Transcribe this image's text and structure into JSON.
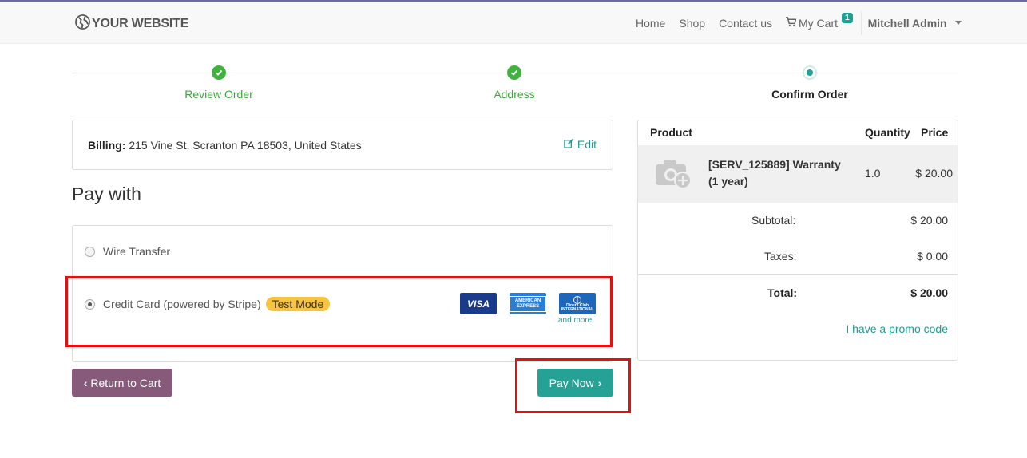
{
  "navbar": {
    "brand": "YOUR WEBSITE",
    "links": [
      "Home",
      "Shop",
      "Contact us"
    ],
    "cart_label": "My Cart",
    "cart_count": "1",
    "user_name": "Mitchell Admin"
  },
  "wizard": {
    "steps": [
      {
        "label": "Review Order",
        "status": "done"
      },
      {
        "label": "Address",
        "status": "done"
      },
      {
        "label": "Confirm Order",
        "status": "current"
      }
    ]
  },
  "billing": {
    "label": "Billing:",
    "address": "215 Vine St, Scranton PA 18503, United States",
    "edit_label": "Edit"
  },
  "payment": {
    "heading": "Pay with",
    "methods": [
      {
        "label": "Wire Transfer",
        "selected": false
      },
      {
        "label": "Credit Card (powered by Stripe)",
        "selected": true,
        "badge": "Test Mode"
      }
    ],
    "card_icons": [
      "VISA",
      "AMERICAN EXPRESS",
      "Diners Club INTERNATIONAL"
    ],
    "and_more": "and more"
  },
  "buttons": {
    "return_label": "Return to Cart",
    "pay_label": "Pay Now"
  },
  "summary": {
    "headers": {
      "product": "Product",
      "quantity": "Quantity",
      "price": "Price"
    },
    "item": {
      "name": "[SERV_125889] Warranty (1 year)",
      "quantity": "1.0",
      "price": "$ 20.00"
    },
    "subtotal_label": "Subtotal:",
    "subtotal": "$ 20.00",
    "taxes_label": "Taxes:",
    "taxes": "$ 0.00",
    "total_label": "Total:",
    "total": "$ 20.00",
    "promo_label": "I have a promo code"
  },
  "colors": {
    "accent": "#21a195",
    "primary": "#875a7b",
    "highlight": "#e80e0e",
    "done_green": "#3fb23f"
  }
}
